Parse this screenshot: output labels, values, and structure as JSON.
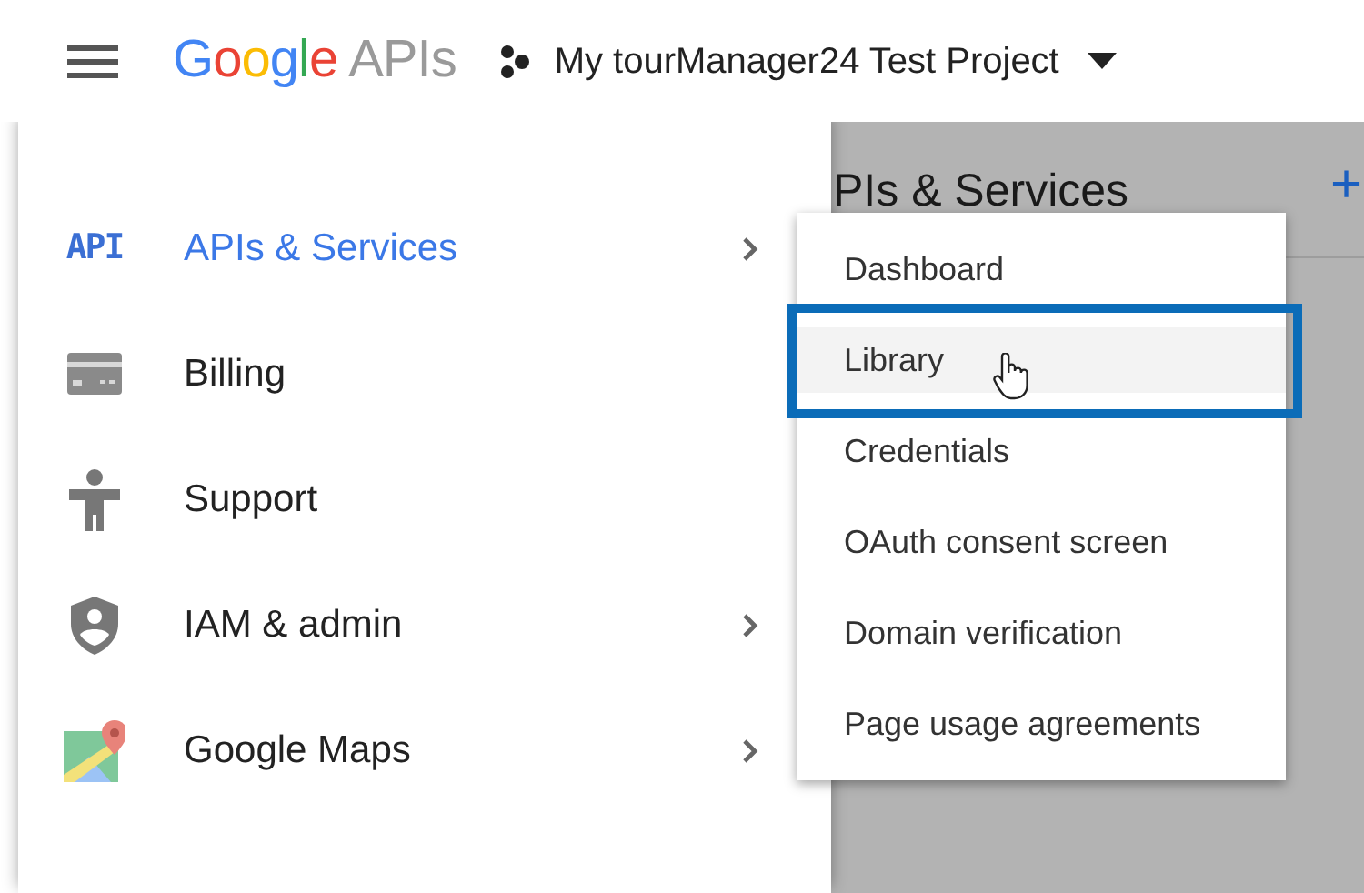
{
  "header": {
    "logo": {
      "brand": "Google",
      "product": "APIs"
    },
    "project": {
      "name": "My tourManager24 Test Project"
    }
  },
  "background_page": {
    "title": "PIs & Services",
    "add_button": "+"
  },
  "nav": {
    "items": [
      {
        "icon_text": "API",
        "label": "APIs & Services",
        "selected": true,
        "submenu": true
      },
      {
        "label": "Billing",
        "selected": false,
        "submenu": false
      },
      {
        "label": "Support",
        "selected": false,
        "submenu": false
      },
      {
        "label": "IAM & admin",
        "selected": false,
        "submenu": true
      },
      {
        "label": "Google Maps",
        "selected": false,
        "submenu": true
      }
    ]
  },
  "dropdown": {
    "items": [
      {
        "label": "Dashboard",
        "selected": false,
        "callout": false
      },
      {
        "label": "Library",
        "selected": true,
        "callout": true
      },
      {
        "label": "Credentials",
        "selected": false,
        "callout": false
      },
      {
        "label": "OAuth consent screen",
        "selected": false,
        "callout": false
      },
      {
        "label": "Domain verification",
        "selected": false,
        "callout": false
      },
      {
        "label": "Page usage agreements",
        "selected": false,
        "callout": false
      }
    ]
  }
}
